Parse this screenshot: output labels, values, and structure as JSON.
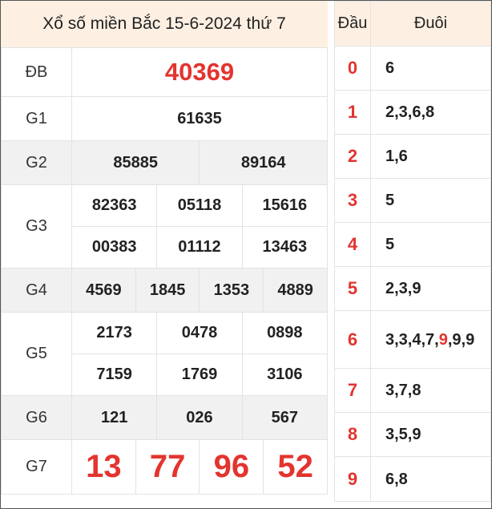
{
  "title": "Xổ số miền Bắc 15-6-2024 thứ 7",
  "prizes": {
    "db": {
      "label": "ĐB",
      "values": [
        "40369"
      ]
    },
    "g1": {
      "label": "G1",
      "values": [
        "61635"
      ]
    },
    "g2": {
      "label": "G2",
      "values": [
        "85885",
        "89164"
      ]
    },
    "g3": {
      "label": "G3",
      "values": [
        "82363",
        "05118",
        "15616",
        "00383",
        "01112",
        "13463"
      ]
    },
    "g4": {
      "label": "G4",
      "values": [
        "4569",
        "1845",
        "1353",
        "4889"
      ]
    },
    "g5": {
      "label": "G5",
      "values": [
        "2173",
        "0478",
        "0898",
        "7159",
        "1769",
        "3106"
      ]
    },
    "g6": {
      "label": "G6",
      "values": [
        "121",
        "026",
        "567"
      ]
    },
    "g7": {
      "label": "G7",
      "values": [
        "13",
        "77",
        "96",
        "52"
      ]
    }
  },
  "loto": {
    "head_label": "Đầu",
    "tail_label": "Đuôi",
    "rows": [
      {
        "dau": "0",
        "duoi": "6"
      },
      {
        "dau": "1",
        "duoi": "2,3,6,8"
      },
      {
        "dau": "2",
        "duoi": "1,6"
      },
      {
        "dau": "3",
        "duoi": "5"
      },
      {
        "dau": "4",
        "duoi": "5"
      },
      {
        "dau": "5",
        "duoi": "2,3,9"
      },
      {
        "dau": "6",
        "duoi_parts": [
          "3,3,4,7,",
          "9",
          ",9,",
          "9"
        ]
      },
      {
        "dau": "7",
        "duoi": "3,7,8"
      },
      {
        "dau": "8",
        "duoi": "3,5,9"
      },
      {
        "dau": "9",
        "duoi": "6,8"
      }
    ]
  },
  "colors": {
    "accent_red": "#e3342f",
    "header_bg": "#fdf0e2",
    "shade_bg": "#f1f1f1"
  }
}
